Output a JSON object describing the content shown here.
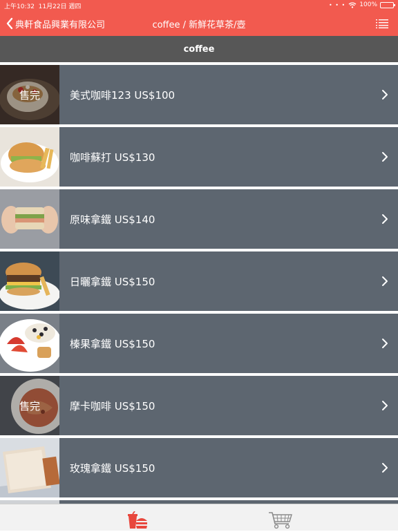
{
  "status_bar": {
    "time": "上午10:32",
    "date": "11月22日 週四",
    "battery": "100%",
    "battery_level": 1.0
  },
  "nav": {
    "back_label": "典軒食品興業有限公司",
    "title": "coffee / 新鮮花草茶/壺"
  },
  "section": {
    "title": "coffee"
  },
  "items": [
    {
      "label": "美式咖啡123 US$100",
      "sold_out": "售完"
    },
    {
      "label": "咖啡蘇打 US$130",
      "sold_out": ""
    },
    {
      "label": "原味拿鐵 US$140",
      "sold_out": ""
    },
    {
      "label": "日曬拿鐵 US$150",
      "sold_out": ""
    },
    {
      "label": "榛果拿鐵 US$150",
      "sold_out": ""
    },
    {
      "label": "摩卡咖啡 US$150",
      "sold_out": "售完"
    },
    {
      "label": "玫瑰拿鐵 US$150",
      "sold_out": ""
    }
  ],
  "icons": {
    "back": "chevron-left-icon",
    "menu": "list-icon",
    "row_arrow": "chevron-right-icon",
    "tab_menu": "drink-food-icon",
    "tab_cart": "shopping-cart-icon"
  },
  "colors": {
    "brand": "#f25a4f",
    "section_header": "#575757",
    "row_background": "#5d6670",
    "tab_active": "#e8473d",
    "tab_inactive": "#8a8a8a"
  }
}
